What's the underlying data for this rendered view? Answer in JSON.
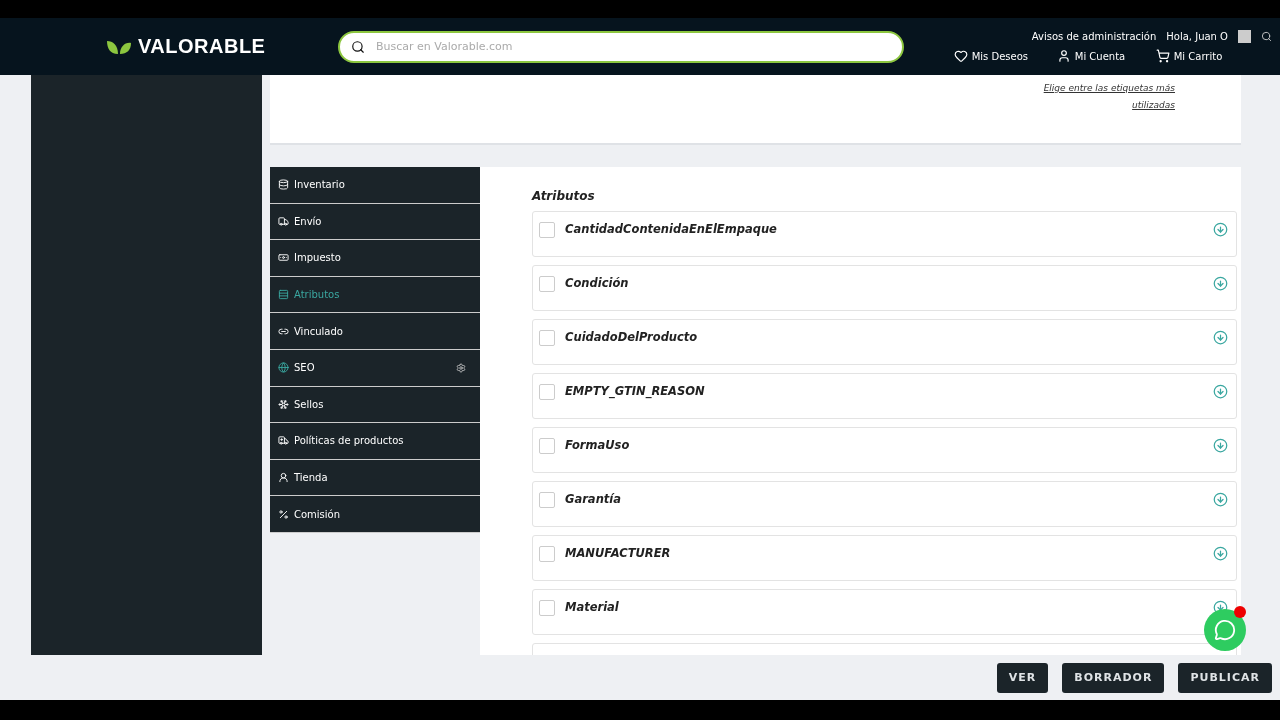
{
  "header": {
    "brand": "VALORABLE",
    "search": {
      "placeholder": "Buscar en Valorable.com"
    },
    "notices": "Avisos de administración",
    "greeting": "Hola, Juan O",
    "nav": [
      "Mis Deseos",
      "Mi Cuenta",
      "Mi Carrito"
    ]
  },
  "tags_card": {
    "link": "Elige entre las etiquetas más utilizadas"
  },
  "tabs": [
    {
      "label": "Inventario",
      "selected": false
    },
    {
      "label": "Envío",
      "selected": false
    },
    {
      "label": "Impuesto",
      "selected": false
    },
    {
      "label": "Atributos",
      "selected": true
    },
    {
      "label": "Vinculado",
      "selected": false
    },
    {
      "label": "SEO",
      "selected": false
    },
    {
      "label": "Sellos",
      "selected": false
    },
    {
      "label": "Políticas de productos",
      "selected": false
    },
    {
      "label": "Tienda",
      "selected": false
    },
    {
      "label": "Comisión",
      "selected": false
    }
  ],
  "attributes": {
    "title": "Atributos",
    "items": [
      {
        "name": "CantidadContenidaEnElEmpaque",
        "checked": false
      },
      {
        "name": "Condición",
        "checked": false
      },
      {
        "name": "CuidadoDelProducto",
        "checked": false
      },
      {
        "name": "EMPTY_GTIN_REASON",
        "checked": false
      },
      {
        "name": "FormaUso",
        "checked": false
      },
      {
        "name": "Garantía",
        "checked": false
      },
      {
        "name": "MANUFACTURER",
        "checked": false
      },
      {
        "name": "Material",
        "checked": false
      }
    ]
  },
  "footer_buttons": [
    "VER",
    "BORRADOR",
    "PUBLICAR"
  ]
}
